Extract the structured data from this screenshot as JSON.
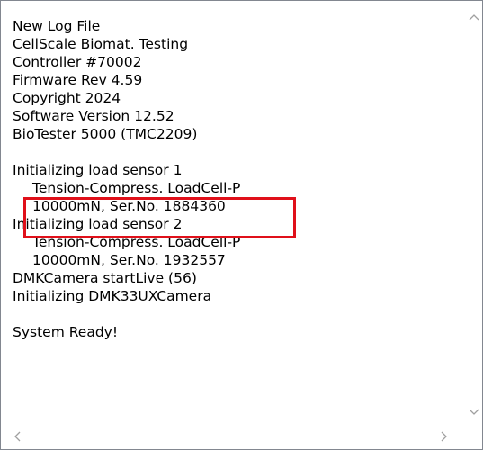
{
  "log": {
    "lines": [
      {
        "text": "New Log File",
        "indent": false
      },
      {
        "text": "CellScale Biomat. Testing",
        "indent": false
      },
      {
        "text": "Controller #70002",
        "indent": false
      },
      {
        "text": "Firmware Rev 4.59",
        "indent": false
      },
      {
        "text": "Copyright 2024",
        "indent": false
      },
      {
        "text": "Software Version 12.52",
        "indent": false
      },
      {
        "text": "BioTester 5000 (TMC2209)",
        "indent": false
      },
      {
        "text": "",
        "indent": false
      },
      {
        "text": "Initializing load sensor 1",
        "indent": false
      },
      {
        "text": "Tension-Compress. LoadCell-P",
        "indent": true
      },
      {
        "text": "10000mN, Ser.No. 1884360",
        "indent": true
      },
      {
        "text": "Initializing load sensor 2",
        "indent": false
      },
      {
        "text": "Tension-Compress. LoadCell-P",
        "indent": true
      },
      {
        "text": "10000mN, Ser.No. 1932557",
        "indent": true
      },
      {
        "text": "DMKCamera startLive (56)",
        "indent": false
      },
      {
        "text": "Initializing DMK33UXCamera",
        "indent": false
      },
      {
        "text": "",
        "indent": false
      },
      {
        "text": "System Ready!",
        "indent": false
      }
    ]
  },
  "highlight": {
    "color": "#e0101a"
  },
  "scrollbar": {
    "arrow_color": "#a0a0a0",
    "up_icon": "chevron-up-icon",
    "down_icon": "chevron-down-icon",
    "left_icon": "chevron-left-icon",
    "right_icon": "chevron-right-icon"
  }
}
